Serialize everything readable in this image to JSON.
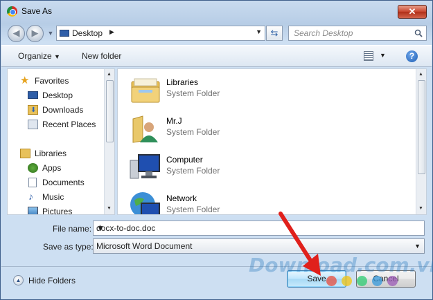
{
  "window": {
    "title": "Save As",
    "close_glyph": "✕"
  },
  "address": {
    "location": "Desktop",
    "search_placeholder": "Search Desktop"
  },
  "toolbar": {
    "organize": "Organize",
    "new_folder": "New folder",
    "help": "?"
  },
  "nav": {
    "favorites": {
      "label": "Favorites",
      "items": [
        "Desktop",
        "Downloads",
        "Recent Places"
      ]
    },
    "libraries": {
      "label": "Libraries",
      "items": [
        "Apps",
        "Documents",
        "Music",
        "Pictures"
      ]
    }
  },
  "files": [
    {
      "name": "Libraries",
      "type": "System Folder",
      "icon": "libraries-folder-icon"
    },
    {
      "name": "Mr.J",
      "type": "System Folder",
      "icon": "user-folder-icon"
    },
    {
      "name": "Computer",
      "type": "System Folder",
      "icon": "computer-icon"
    },
    {
      "name": "Network",
      "type": "System Folder",
      "icon": "network-icon"
    }
  ],
  "form": {
    "file_name_label": "File name:",
    "file_name_value": "docx-to-doc.doc",
    "save_as_type_label": "Save as type:",
    "save_as_type_value": "Microsoft Word Document"
  },
  "footer": {
    "hide_folders": "Hide Folders",
    "save": "Save",
    "cancel": "Cancel"
  },
  "watermark": {
    "text": "Download.com.vn",
    "dot_colors": [
      "#e74c3c",
      "#f1c40f",
      "#2ecc71",
      "#3498db",
      "#9b59b6"
    ]
  },
  "colors": {
    "annotation_arrow": "#e0201b",
    "accent": "#3c7fb1"
  }
}
